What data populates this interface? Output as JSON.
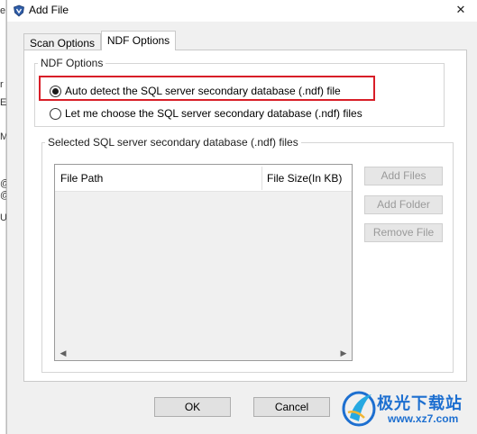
{
  "background_fragments": [
    "e",
    "r",
    "E",
    "M",
    "@",
    "@",
    "U"
  ],
  "window": {
    "title": "Add File",
    "close_glyph": "✕",
    "app_icon": "shield-logo-icon"
  },
  "tabs": [
    {
      "label": "Scan Options",
      "active": false
    },
    {
      "label": "NDF Options",
      "active": true
    }
  ],
  "ndf_options": {
    "legend": "NDF Options",
    "options": [
      {
        "label": "Auto detect the SQL server secondary database (.ndf) file",
        "selected": true
      },
      {
        "label": "Let me choose the SQL server secondary database (.ndf) files",
        "selected": false
      }
    ],
    "highlight_color": "#d81e28"
  },
  "files_group": {
    "legend": "Selected SQL server  secondary database (.ndf) files",
    "columns": [
      "File Path",
      "File Size(In KB)"
    ],
    "rows": [],
    "buttons": [
      "Add Files",
      "Add Folder",
      "Remove File"
    ]
  },
  "dialog_buttons": {
    "ok": "OK",
    "cancel": "Cancel"
  },
  "watermark": {
    "name": "极光下载站",
    "url": "www.xz7.com",
    "color": "#1d6fd0"
  }
}
